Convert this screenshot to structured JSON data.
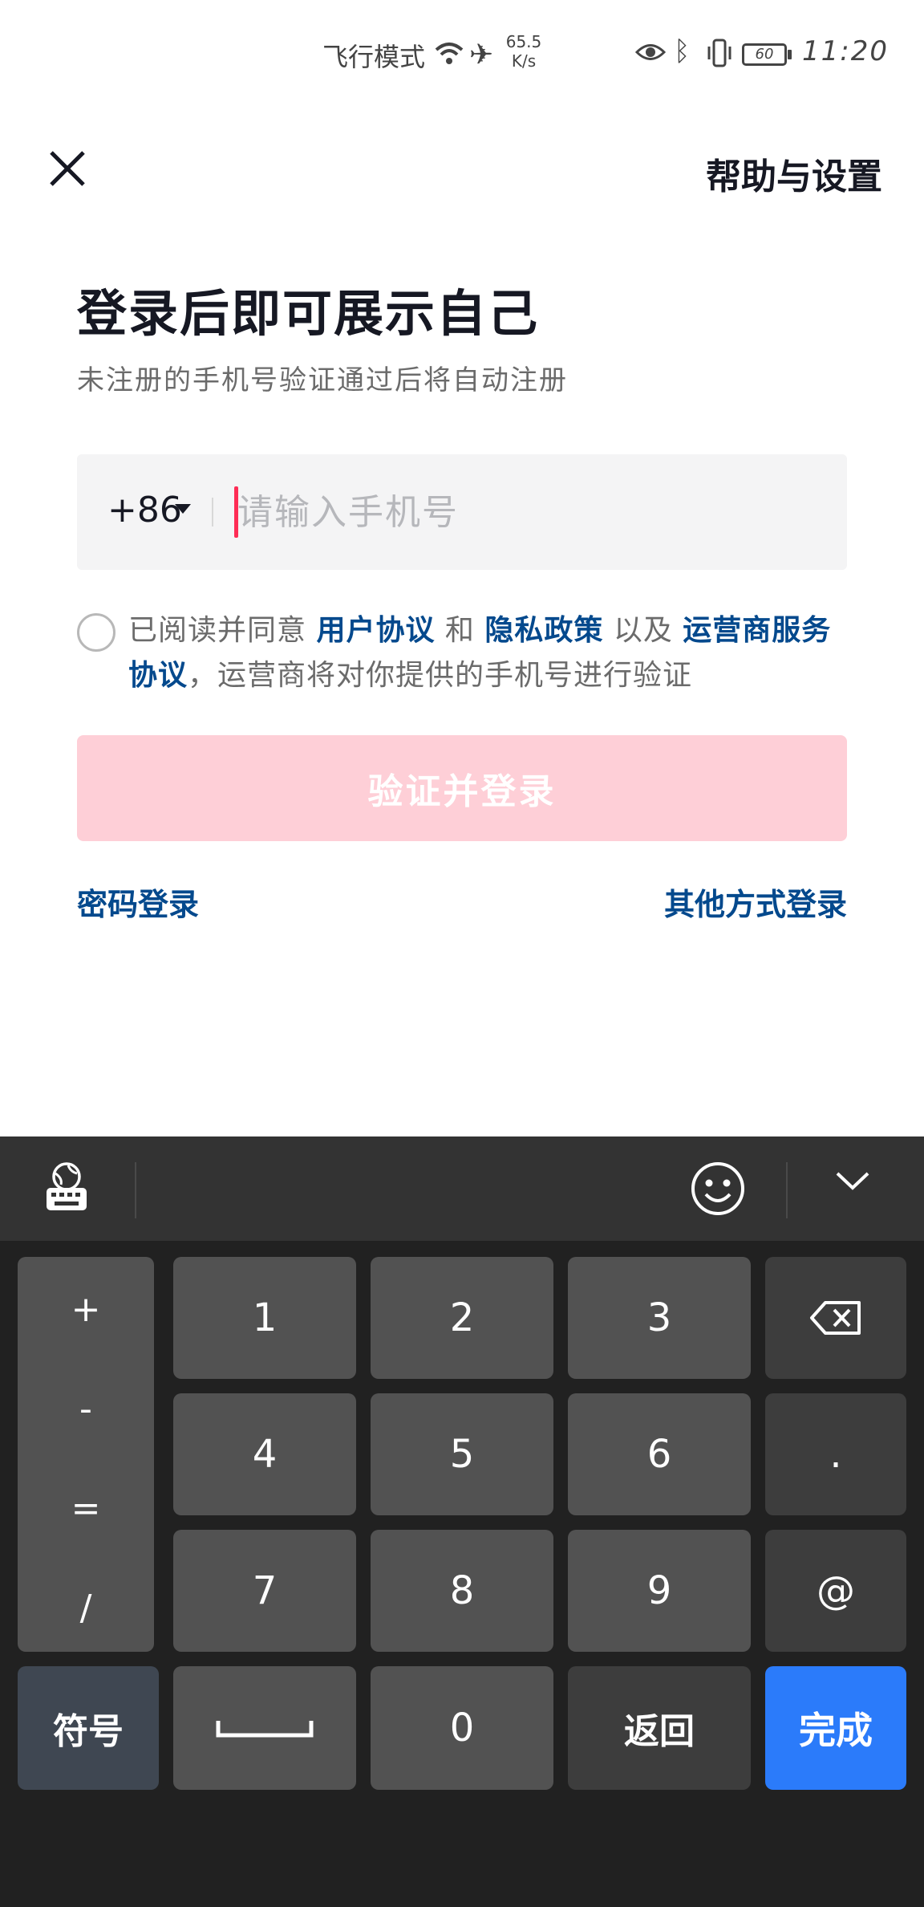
{
  "status_bar": {
    "airplane_mode_text": "飞行模式",
    "net_speed_value": "65.5",
    "net_speed_unit": "K/s",
    "battery": "60",
    "time": "11:20",
    "icons": [
      "wifi-icon",
      "airplane-icon",
      "eye-icon",
      "bluetooth-icon",
      "vibrate-icon",
      "battery-icon"
    ]
  },
  "header": {
    "close_icon": "close-icon",
    "help_link": "帮助与设置"
  },
  "main": {
    "title": "登录后即可展示自己",
    "subtitle": "未注册的手机号验证通过后将自动注册",
    "phone": {
      "country_code": "+86",
      "placeholder": "请输入手机号",
      "value": ""
    },
    "agreement": {
      "prefix": "已阅读并同意 ",
      "user_agreement": "用户协议",
      "and": " 和 ",
      "privacy_policy": "隐私政策",
      "also": " 以及 ",
      "carrier_agreement": "运营商服务协议",
      "suffix": "，运营商将对你提供的手机号进行验证"
    },
    "login_button": "验证并登录",
    "password_login": "密码登录",
    "other_login": "其他方式登录",
    "accent_color": "#fe2c55",
    "link_color": "#04498d"
  },
  "keyboard": {
    "toolbar_icons": [
      "keyboard-globe-icon",
      "emoji-icon",
      "collapse-chevron-icon"
    ],
    "side_keys": [
      "+",
      "-",
      "=",
      "/"
    ],
    "digits": [
      "1",
      "2",
      "3",
      "4",
      "5",
      "6",
      "7",
      "8",
      "9",
      "0"
    ],
    "dot": ".",
    "at": "@",
    "symbols": "符号",
    "back": "返回",
    "done": "完成",
    "space_icon": "space-icon",
    "backspace_icon": "backspace-icon"
  }
}
